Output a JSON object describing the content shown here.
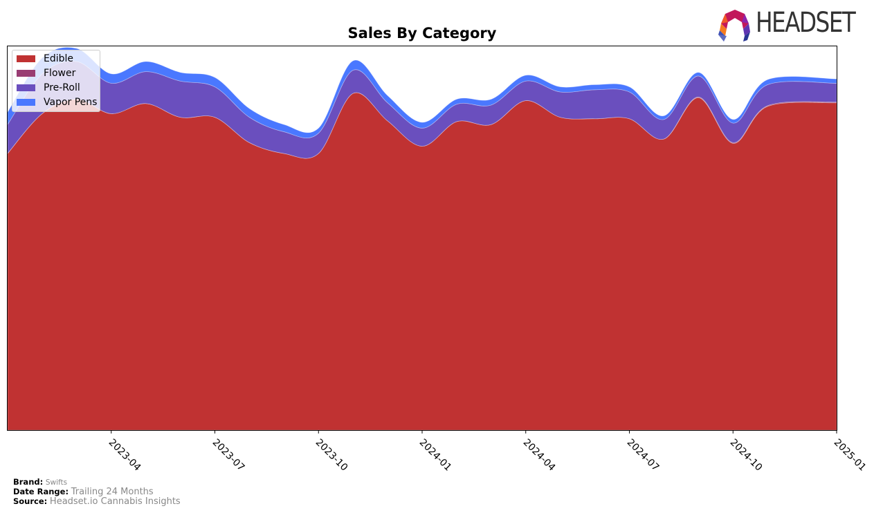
{
  "logo": {
    "text": "HEADSET"
  },
  "chart_data": {
    "type": "area",
    "stacked": true,
    "title": "Sales By Category",
    "xlabel": "",
    "ylabel": "",
    "y_ticks_visible": false,
    "grid": false,
    "legend_position": "top-left",
    "x": [
      "2023-01",
      "2023-02",
      "2023-03",
      "2023-04",
      "2023-05",
      "2023-06",
      "2023-07",
      "2023-08",
      "2023-09",
      "2023-10",
      "2023-11",
      "2023-12",
      "2024-01",
      "2024-02",
      "2024-03",
      "2024-04",
      "2024-05",
      "2024-06",
      "2024-07",
      "2024-08",
      "2024-09",
      "2024-10",
      "2024-11",
      "2024-12"
    ],
    "x_tick_labels": [
      "2023-04",
      "2023-07",
      "2023-10",
      "2024-01",
      "2024-04",
      "2024-07",
      "2024-10",
      "2025-01"
    ],
    "x_range": [
      "2023-01",
      "2025-01"
    ],
    "ylim": [
      0,
      530
    ],
    "series": [
      {
        "name": "Edible",
        "color": "#c03232",
        "values": [
          382,
          437,
          457,
          437,
          451,
          432,
          432,
          397,
          382,
          382,
          465,
          427,
          392,
          426,
          422,
          455,
          432,
          430,
          430,
          402,
          459,
          396,
          447,
          452
        ]
      },
      {
        "name": "Flower",
        "color": "#993d73",
        "values": [
          0,
          0,
          0,
          0,
          0,
          0,
          0,
          0,
          0,
          0,
          0,
          0,
          0,
          0,
          0,
          0,
          0,
          0,
          0,
          0,
          1,
          1,
          1,
          1
        ]
      },
      {
        "name": "Pre-Roll",
        "color": "#6a4fbe",
        "values": [
          40,
          55,
          52,
          42,
          44,
          50,
          42,
          35,
          30,
          28,
          32,
          25,
          25,
          24,
          27,
          27,
          35,
          40,
          37,
          27,
          29,
          27,
          29,
          26
        ]
      },
      {
        "name": "Vapor Pens",
        "color": "#4a78ff",
        "values": [
          17,
          22,
          18,
          13,
          14,
          12,
          13,
          12,
          10,
          7,
          13,
          10,
          8,
          7,
          8,
          8,
          7,
          7,
          7,
          5,
          5,
          5,
          7,
          6
        ]
      }
    ]
  },
  "legend": [
    {
      "label": "Edible",
      "color": "#c03232"
    },
    {
      "label": "Flower",
      "color": "#993d73"
    },
    {
      "label": "Pre-Roll",
      "color": "#6a4fbe"
    },
    {
      "label": "Vapor Pens",
      "color": "#4a78ff"
    }
  ],
  "footer": {
    "brand_label": "Brand:",
    "brand_value": "Swifts",
    "date_range_label": "Date Range:",
    "date_range_value": "Trailing 24 Months",
    "source_label": "Source:",
    "source_value": "Headset.io Cannabis Insights"
  }
}
